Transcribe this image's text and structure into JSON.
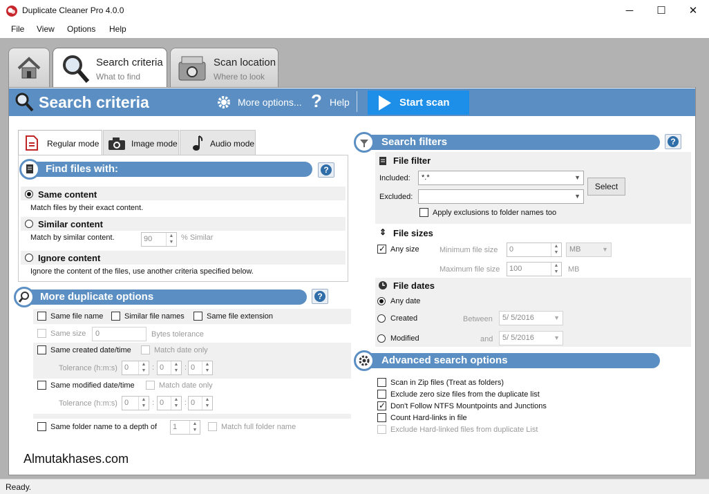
{
  "window": {
    "title": "Duplicate Cleaner Pro 4.0.0",
    "minimize": "─",
    "maximize": "☐",
    "close": "✕"
  },
  "menu": [
    "File",
    "View",
    "Options",
    "Help"
  ],
  "tabs": {
    "home": "home-icon",
    "search": {
      "title": "Search criteria",
      "sub": "What to find"
    },
    "scan": {
      "title": "Scan location",
      "sub": "Where to look"
    }
  },
  "header": {
    "title": "Search criteria",
    "more_options": "More options...",
    "help": "Help",
    "start_scan": "Start scan"
  },
  "modes": {
    "regular": "Regular mode",
    "image": "Image mode",
    "audio": "Audio mode"
  },
  "find_files": {
    "title": "Find files with:",
    "same_content": {
      "label": "Same content",
      "desc": "Match files by their exact content."
    },
    "similar_content": {
      "label": "Similar content",
      "desc": "Match by similar content.",
      "value": "90",
      "unit": "% Similar"
    },
    "ignore_content": {
      "label": "Ignore content",
      "desc": "Ignore the content of the files, use another criteria specified below."
    }
  },
  "more_dup": {
    "title": "More duplicate options",
    "same_file_name": "Same file name",
    "similar_file_names": "Similar file names",
    "same_file_extension": "Same file extension",
    "same_size": "Same size",
    "same_size_value": "0",
    "bytes_tolerance": "Bytes tolerance",
    "same_created": "Same created date/time",
    "match_date_only": "Match date only",
    "tolerance": "Tolerance (h:m:s)",
    "same_modified": "Same modified date/time",
    "same_folder": "Same folder name to a depth of",
    "depth_value": "1",
    "match_full_folder": "Match full folder name",
    "zero": "0",
    "colon": ":"
  },
  "filters": {
    "title": "Search filters",
    "file_filter": "File filter",
    "included_label": "Included:",
    "included_value": "*.*",
    "excluded_label": "Excluded:",
    "select": "Select",
    "apply_exclusions": "Apply exclusions to folder names too",
    "file_sizes": "File sizes",
    "any_size": "Any size",
    "min_size": "Minimum file size",
    "min_value": "0",
    "min_unit": "MB",
    "max_size": "Maximum file size",
    "max_value": "100",
    "max_unit": "MB",
    "file_dates": "File dates",
    "any_date": "Any date",
    "created": "Created",
    "between": "Between",
    "date1": "5/  5/2016",
    "modified": "Modified",
    "and": "and",
    "date2": "5/  5/2016"
  },
  "advanced": {
    "title": "Advanced search options",
    "scan_zip": "Scan in Zip files (Treat as folders)",
    "exclude_zero": "Exclude zero size files from the duplicate list",
    "dont_follow": "Don't Follow NTFS Mountpoints and Junctions",
    "count_hardlinks": "Count Hard-links in file",
    "exclude_hardlinked": "Exclude Hard-linked files from duplicate List"
  },
  "watermark": "Almutakhases.com",
  "status": "Ready."
}
